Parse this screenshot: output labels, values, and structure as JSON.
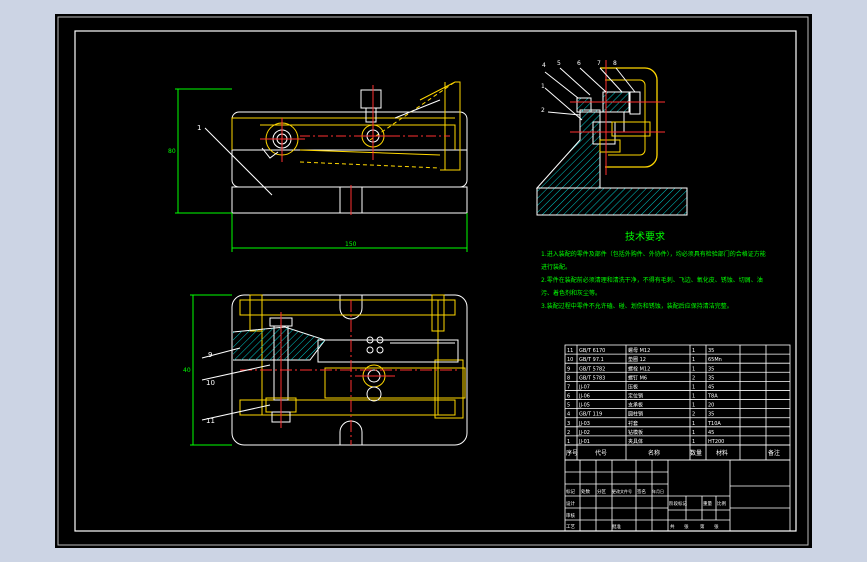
{
  "colors": {
    "background_outer": "#ccd4e4",
    "sheet": "#000000",
    "border": "#ffffff",
    "part_outline": "#ffffff",
    "hidden_line": "#ffd700",
    "center_line": "#ff3030",
    "hatch": "#00c8c8",
    "dimension": "#00ff00",
    "title_block": "#ffffff",
    "note_text": "#00ff00",
    "leader": "#ffffff"
  },
  "drawing": {
    "dims": {
      "front_height": "80",
      "front_width": "150",
      "top_height": "40"
    },
    "balloons_left": [
      "1",
      "9",
      "10",
      "11"
    ],
    "balloons_right": [
      "4",
      "5",
      "6",
      "7",
      "8",
      "1",
      "2"
    ]
  },
  "notes": {
    "title": "技术要求",
    "lines": [
      "1.进入装配的零件及部件（包括外购件、外协件），均必须具有检验部门的合格证方能",
      "进行装配。",
      "2.零件在装配前必须清理和清洗干净，不得有毛刺、飞边、氧化皮、锈蚀、切屑、油",
      "污、着色剂和灰尘等。",
      "3.装配过程中零件不允许磕、碰、划伤和锈蚀，装配后应保持清洁完整。"
    ]
  },
  "title_block": {
    "headers": {
      "seq": "序号",
      "code": "代号",
      "name": "名称",
      "qty": "数量",
      "material": "材料",
      "note": "备注"
    },
    "rows": [
      {
        "seq": "11",
        "code": "GB/T 6170",
        "name": "螺母 M12",
        "qty": "1",
        "material": "35"
      },
      {
        "seq": "10",
        "code": "GB/T 97.1",
        "name": "垫圈 12",
        "qty": "1",
        "material": "65Mn"
      },
      {
        "seq": "9",
        "code": "GB/T 5782",
        "name": "螺栓 M12",
        "qty": "1",
        "material": "35"
      },
      {
        "seq": "8",
        "code": "GB/T 5783",
        "name": "螺钉 M6",
        "qty": "2",
        "material": "35"
      },
      {
        "seq": "7",
        "code": "JJ-07",
        "name": "压板",
        "qty": "1",
        "material": "45"
      },
      {
        "seq": "6",
        "code": "JJ-06",
        "name": "定位销",
        "qty": "1",
        "material": "T8A"
      },
      {
        "seq": "5",
        "code": "JJ-05",
        "name": "支承板",
        "qty": "1",
        "material": "20"
      },
      {
        "seq": "4",
        "code": "GB/T 119",
        "name": "圆柱销",
        "qty": "2",
        "material": "35"
      },
      {
        "seq": "3",
        "code": "JJ-03",
        "name": "衬套",
        "qty": "1",
        "material": "T10A"
      },
      {
        "seq": "2",
        "code": "JJ-02",
        "name": "钻模板",
        "qty": "1",
        "material": "45"
      },
      {
        "seq": "1",
        "code": "JJ-01",
        "name": "夹具体",
        "qty": "1",
        "material": "HT200"
      }
    ],
    "sign_labels": [
      "标记",
      "处数",
      "分区",
      "更改文件号",
      "签名",
      "年月日"
    ],
    "role_labels": [
      "设计",
      "审核",
      "工艺",
      "批准"
    ],
    "stage_labels": [
      "阶段标记",
      "重量",
      "比例"
    ],
    "sheet_labels": [
      "共",
      "张",
      "第",
      "张"
    ]
  }
}
